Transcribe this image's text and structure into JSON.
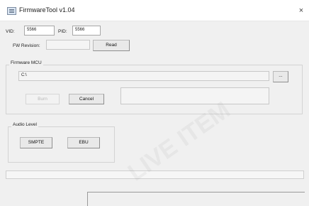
{
  "window": {
    "title": "FirmwareTool v1.04",
    "close_glyph": "×"
  },
  "ids": {
    "vid_label": "VID:",
    "vid_value": "5566",
    "pid_label": "PID:",
    "pid_value": "5566"
  },
  "fw": {
    "label": "FW Revision:",
    "value": "",
    "read_label": "Read"
  },
  "firmware_mcu": {
    "legend": "Firmware MCU",
    "path": "C:\\",
    "browse_label": "...",
    "burn_label": "Burn",
    "cancel_label": "Cancel",
    "status": ""
  },
  "audio": {
    "legend": "Audio Level",
    "smpte_label": "SMPTE",
    "ebu_label": "EBU"
  },
  "watermark": {
    "text": "LIVE ITEM"
  }
}
